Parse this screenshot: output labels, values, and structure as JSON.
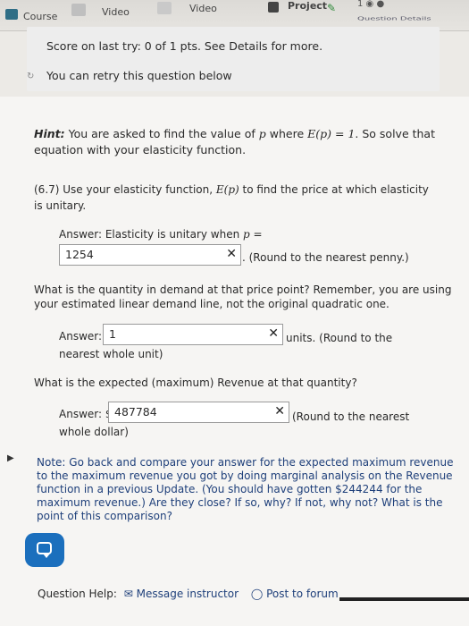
{
  "tabs": {
    "course": "Course",
    "video1": "Video",
    "video2": "Video",
    "project": "Project",
    "right_partial": "Question Details"
  },
  "status": {
    "score": "Score on last try: 0 of 1 pts. See Details for more.",
    "retry": "You can retry this question below"
  },
  "hint": {
    "prefix": "Hint:",
    "text_a": "You are asked to find the value of",
    "var_p": "p",
    "text_b": "where",
    "equation": "E(p) = 1",
    "text_c": ". So solve that",
    "line2": "equation with your elasticity function."
  },
  "question": {
    "line1a": "(6.7) Use your elasticity function,",
    "func": "E(p)",
    "line1b": "to find the price at which elasticity",
    "line2": "is unitary."
  },
  "answer1": {
    "label_a": "Answer: Elasticity is unitary when",
    "label_var": "p =",
    "value": "1254",
    "suffix": ". (Round to the nearest penny.)"
  },
  "q2": {
    "line1": "What is the quantity in demand at that price point? Remember, you are using",
    "line2": "your estimated linear demand line, not the original quadratic one."
  },
  "answer2": {
    "label": "Answer:",
    "value": "1",
    "suffix": "units. (Round to the",
    "suffix2": "nearest whole unit)"
  },
  "q3": {
    "text": "What is the expected (maximum) Revenue at that quantity?"
  },
  "answer3": {
    "label": "Answer: $",
    "value": "487784",
    "suffix": "(Round to the nearest",
    "suffix2": "whole dollar)"
  },
  "note": {
    "l1": "Note: Go back and compare your answer for the expected maximum revenue",
    "l2": "to the maximum revenue you got by doing marginal analysis on the Revenue",
    "l3": "function in a previous Update. (You should have gotten $244244 for the",
    "l4": "maximum revenue.) Are they close? If so, why? If not, why not? What is the",
    "l5": "point of this comparison?"
  },
  "footer": {
    "help": "Question Help:",
    "message": "Message instructor",
    "forum": "Post to forum"
  },
  "colors": {
    "accent": "#1b6fbd",
    "note": "#1e3f7a",
    "link": "#1e3f7a"
  }
}
